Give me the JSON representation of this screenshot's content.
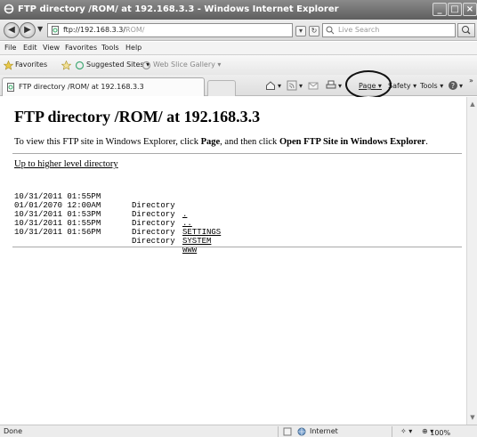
{
  "window": {
    "title": "FTP directory /ROM/ at 192.168.3.3 - Windows Internet Explorer"
  },
  "address_bar": {
    "url_host": "ftp://192.168.3.3/",
    "url_path": "ROM/",
    "search_placeholder": "Live Search"
  },
  "menu": [
    "File",
    "Edit",
    "View",
    "Favorites",
    "Tools",
    "Help"
  ],
  "favorites_bar": {
    "favorites_label": "Favorites",
    "suggested_sites": "Suggested Sites",
    "web_slice_gallery": "Web Slice Gallery"
  },
  "tab": {
    "label": "FTP directory /ROM/ at 192.168.3.3"
  },
  "command_bar": {
    "page": "Page",
    "safety": "Safety",
    "tools": "Tools"
  },
  "page": {
    "heading": "FTP directory /ROM/ at 192.168.3.3",
    "intro_prefix": "To view this FTP site in Windows Explorer, click ",
    "intro_page": "Page",
    "intro_middle": ", and then click ",
    "intro_open": "Open FTP Site in Windows Explorer",
    "intro_suffix": ".",
    "up_link": "Up to higher level directory",
    "entries": [
      {
        "date": "10/31/2011 01:55PM",
        "kind": "Directory",
        "name": "."
      },
      {
        "date": "01/01/2070 12:00AM",
        "kind": "Directory",
        "name": ".."
      },
      {
        "date": "10/31/2011 01:53PM",
        "kind": "Directory",
        "name": "SETTINGS"
      },
      {
        "date": "10/31/2011 01:55PM",
        "kind": "Directory",
        "name": "SYSTEM"
      },
      {
        "date": "10/31/2011 01:56PM",
        "kind": "Directory",
        "name": "WWW"
      }
    ]
  },
  "status_bar": {
    "status": "Done",
    "zone": "Internet",
    "zoom": "100%"
  },
  "colors": {
    "titlebar": "#6e6e6e",
    "highlight_ring": "#111111"
  }
}
